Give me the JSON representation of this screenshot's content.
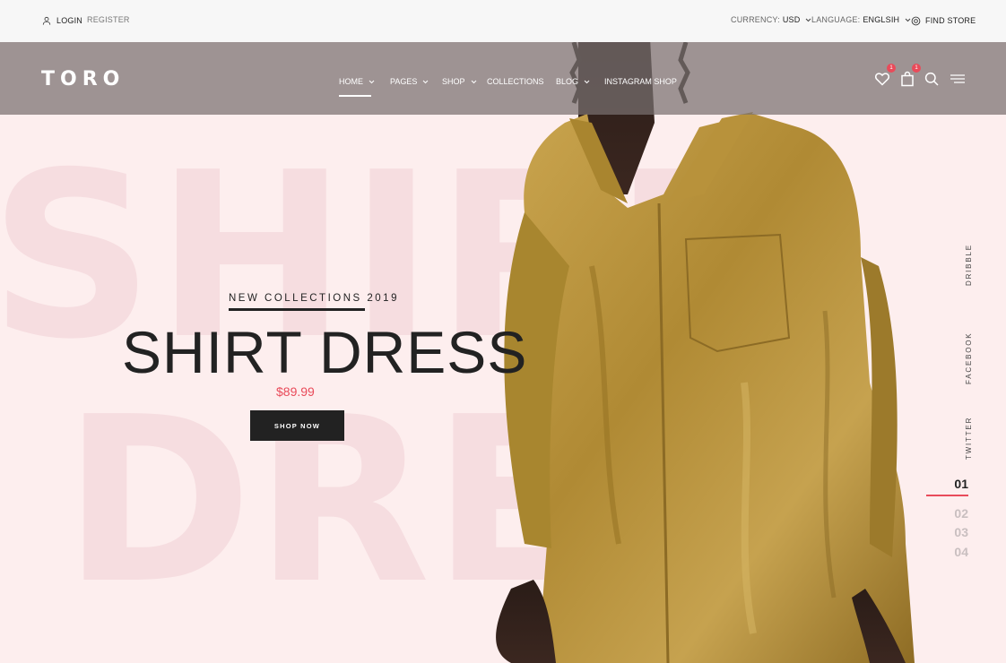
{
  "topbar": {
    "login": "LOGIN",
    "register": "REGISTER",
    "currency_label": "CURRENCY:",
    "currency_value": "USD",
    "language_label": "LANGUAGE:",
    "language_value": "ENGLSIH",
    "find_store": "FIND STORE"
  },
  "header": {
    "logo": "TORO",
    "nav": {
      "home": "HOME",
      "pages": "PAGES",
      "shop": "SHOP",
      "collections": "COLLECTIONS",
      "blog": "BLOG",
      "instagram": "INSTAGRAM SHOP"
    },
    "wishlist_count": "1",
    "cart_count": "1"
  },
  "hero": {
    "background_text_1": "SHIRD",
    "background_text_2": "DRES",
    "tagline": "NEW COLLECTIONS 2019",
    "title": "SHIRT DRESS",
    "price": "$89.99",
    "cta": "SHOP NOW"
  },
  "social": {
    "dribbble": "DRIBBLE",
    "facebook": "FACEBOOK",
    "twitter": "TWITTER"
  },
  "pagination": {
    "active": "01",
    "p2": "02",
    "p3": "03",
    "p4": "04"
  },
  "colors": {
    "accent": "#e94b5a",
    "hero_bg": "#fdeeee",
    "dark": "#222222"
  }
}
